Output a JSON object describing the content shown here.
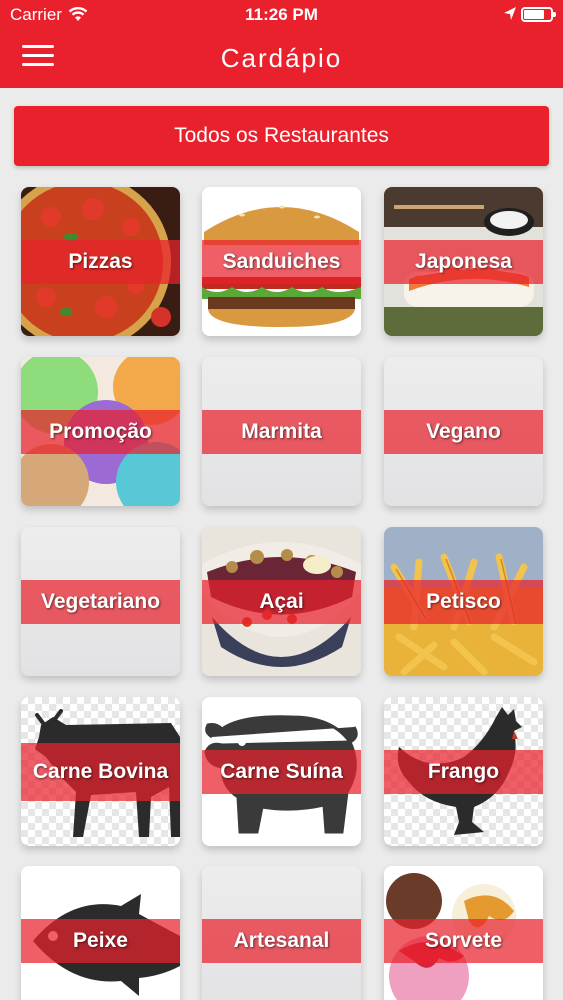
{
  "status_bar": {
    "carrier": "Carrier",
    "time": "11:26 PM",
    "battery_level": 0.75
  },
  "nav": {
    "title": "Cardápio",
    "menu_icon": "hamburger-menu-icon"
  },
  "all_restaurants_button": "Todos os Restaurantes",
  "categories": [
    {
      "label": "Pizzas"
    },
    {
      "label": "Sanduiches"
    },
    {
      "label": "Japonesa"
    },
    {
      "label": "Promoção"
    },
    {
      "label": "Marmita"
    },
    {
      "label": "Vegano"
    },
    {
      "label": "Vegetariano"
    },
    {
      "label": "Açai"
    },
    {
      "label": "Petisco"
    },
    {
      "label": "Carne Bovina"
    },
    {
      "label": "Carne Suína"
    },
    {
      "label": "Frango"
    },
    {
      "label": "Peixe"
    },
    {
      "label": "Artesanal"
    },
    {
      "label": "Sorvete"
    }
  ],
  "colors": {
    "brand_red": "#e8212d",
    "background": "#ebebeb"
  }
}
